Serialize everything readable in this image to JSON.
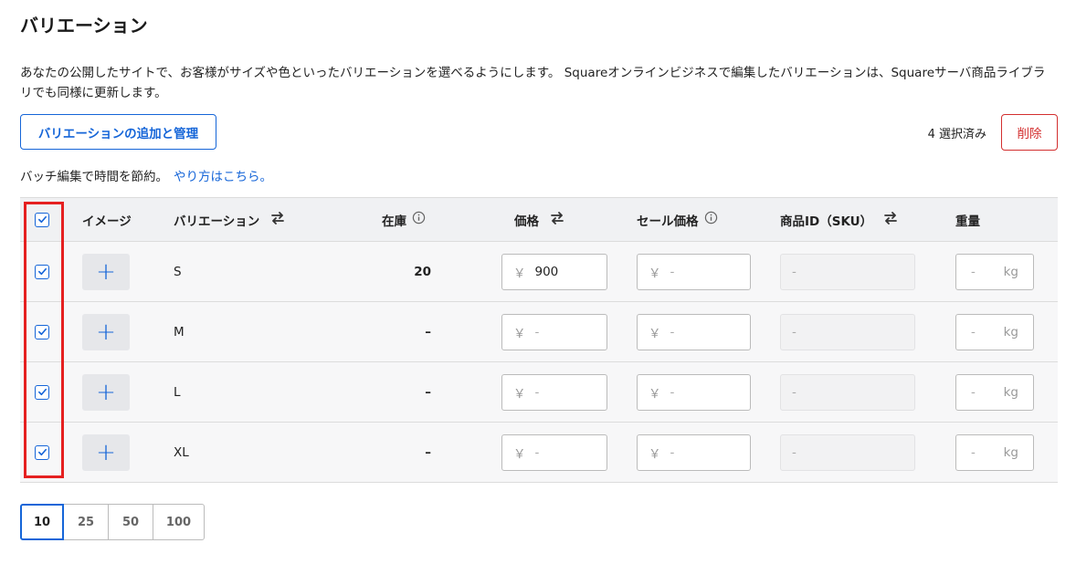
{
  "page": {
    "title": "バリエーション",
    "description": "あなたの公開したサイトで、お客様がサイズや色といったバリエーションを選べるようにします。 Squareオンラインビジネスで編集したバリエーションは、Squareサーバ商品ライブラリでも同様に更新します。",
    "manage_button": "バリエーションの追加と管理",
    "selected_count": "4 選択済み",
    "delete_button": "削除",
    "batch_text": "バッチ編集で時間を節約。",
    "batch_link": "やり方はこちら。"
  },
  "table": {
    "headers": {
      "image": "イメージ",
      "variation": "バリエーション",
      "stock": "在庫",
      "price": "価格",
      "sale_price": "セール価格",
      "sku": "商品ID（SKU）",
      "weight": "重量"
    },
    "rows": [
      {
        "name": "S",
        "stock": "20",
        "price": "900",
        "sale_price": "-",
        "sku": "-",
        "weight": "-",
        "unit": "kg",
        "checked": true
      },
      {
        "name": "M",
        "stock": "–",
        "price": "-",
        "sale_price": "-",
        "sku": "-",
        "weight": "-",
        "unit": "kg",
        "checked": true
      },
      {
        "name": "L",
        "stock": "–",
        "price": "-",
        "sale_price": "-",
        "sku": "-",
        "weight": "-",
        "unit": "kg",
        "checked": true
      },
      {
        "name": "XL",
        "stock": "–",
        "price": "-",
        "sale_price": "-",
        "sku": "-",
        "weight": "-",
        "unit": "kg",
        "checked": true
      }
    ],
    "currency_symbol": "￥",
    "add_image_symbol": "+"
  },
  "pagination": {
    "options": [
      "10",
      "25",
      "50",
      "100"
    ],
    "selected": "10"
  },
  "colors": {
    "accent": "#1565d8",
    "danger": "#d32f2f",
    "highlight": "#e52020"
  },
  "icons": [
    "checkbox-checked-icon",
    "plus-icon",
    "swap-arrows-icon",
    "info-icon"
  ]
}
